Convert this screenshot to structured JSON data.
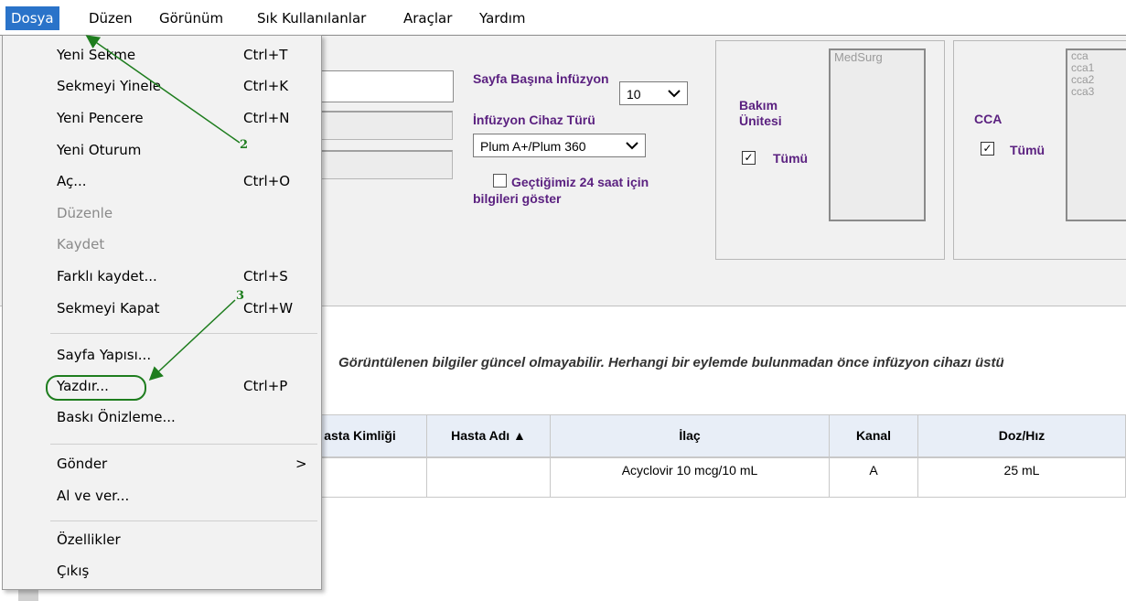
{
  "menubar": {
    "items": [
      {
        "label": "Dosya"
      },
      {
        "label": "Düzen"
      },
      {
        "label": "Görünüm"
      },
      {
        "label": "Sık Kullanılanlar"
      },
      {
        "label": "Araçlar"
      },
      {
        "label": "Yardım"
      }
    ]
  },
  "file_menu": {
    "items": [
      {
        "label": "Yeni Sekme",
        "shortcut": "Ctrl+T"
      },
      {
        "label": "Sekmeyi Yinele",
        "shortcut": "Ctrl+K"
      },
      {
        "label": "Yeni Pencere",
        "shortcut": "Ctrl+N"
      },
      {
        "label": "Yeni Oturum",
        "shortcut": ""
      },
      {
        "label": "Aç...",
        "shortcut": "Ctrl+O"
      },
      {
        "label": "Düzenle",
        "shortcut": ""
      },
      {
        "label": "Kaydet",
        "shortcut": ""
      },
      {
        "label": "Farklı kaydet...",
        "shortcut": "Ctrl+S"
      },
      {
        "label": "Sekmeyi Kapat",
        "shortcut": "Ctrl+W"
      },
      {
        "label": "Sayfa Yapısı...",
        "shortcut": ""
      },
      {
        "label": "Yazdır...",
        "shortcut": "Ctrl+P"
      },
      {
        "label": "Baskı Önizleme...",
        "shortcut": ""
      },
      {
        "label": "Gönder",
        "shortcut": ""
      },
      {
        "label": "Al ve ver...",
        "shortcut": ""
      },
      {
        "label": "Özellikler",
        "shortcut": ""
      },
      {
        "label": "Çıkış",
        "shortcut": ""
      }
    ],
    "submenu_arrow": ">"
  },
  "annotations": {
    "step2": "2",
    "step3": "3",
    "color": "#1e7d1e"
  },
  "filters": {
    "per_page_label": "Sayfa Başına İnfüzyon",
    "per_page_value": "10",
    "device_type_label": "İnfüzyon Cihaz Türü",
    "device_type_value": "Plum A+/Plum 360",
    "last24_label": "Geçtiğimiz 24 saat için bilgileri göster",
    "care_unit_label": "Bakım Ünitesi",
    "care_unit_all": "Tümü",
    "care_unit_list": [
      "MedSurg"
    ],
    "cca_label": "CCA",
    "cca_all": "Tümü",
    "cca_list": [
      "cca",
      "cca1",
      "cca2",
      "cca3"
    ]
  },
  "warning_text": "Görüntülenen bilgiler güncel olmayabilir. Herhangi bir eylemde bulunmadan önce infüzyon cihazı üstü",
  "table": {
    "headers": [
      "asta Kimliği",
      "Hasta Adı ▲",
      "İlaç",
      "Kanal",
      "Doz/Hız"
    ],
    "rows": [
      [
        "",
        "",
        "Acyclovir 10 mcg/10 mL",
        "A",
        "25 mL"
      ]
    ]
  },
  "colors": {
    "menu_active": "#2a73c9",
    "purple_label": "#5b2180",
    "annotation_green": "#1e7d1e"
  }
}
